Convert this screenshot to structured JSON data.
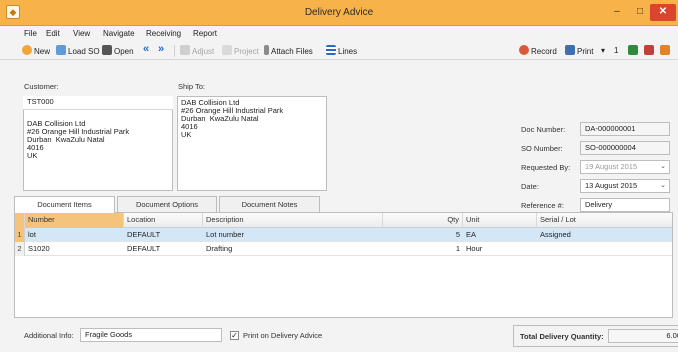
{
  "window": {
    "title": "Delivery Advice",
    "minimize_glyph": "–",
    "maximize_glyph": "□",
    "close_glyph": "✕"
  },
  "menu": [
    "File",
    "Edit",
    "View",
    "Navigate",
    "Receiving",
    "Report"
  ],
  "toolbar": {
    "new": "New",
    "load_so": "Load SO",
    "open": "Open",
    "prev": "«",
    "next": "»",
    "adjust": "Adjust",
    "project": "Project",
    "attach": "Attach Files",
    "lines": "Lines",
    "record": "Record",
    "print": "Print",
    "print_arrow": "▾",
    "copies": "1"
  },
  "customer": {
    "label": "Customer:",
    "code": "TST000",
    "address": "DAB Collision Ltd\n#26 Orange Hill Industrial Park\nDurban  KwaZulu Natal\n4016\nUK"
  },
  "ship_to": {
    "label": "Ship To:",
    "address": "DAB Collision Ltd\n#26 Orange Hill Industrial Park\nDurban  KwaZulu Natal\n4016\nUK"
  },
  "doc": {
    "doc_number_label": "Doc Number:",
    "doc_number": "DA-000000001",
    "so_number_label": "SO Number:",
    "so_number": "SO-000000004",
    "requested_by_label": "Requested By:",
    "requested_by": "19  August  2015",
    "date_label": "Date:",
    "date": "13  August  2015",
    "reference_label": "Reference #:",
    "reference": "Delivery"
  },
  "tabs": [
    "Document Items",
    "Document Options",
    "Document Notes"
  ],
  "grid": {
    "columns": [
      "Number",
      "Location",
      "Description",
      "Qty",
      "Unit",
      "Serial / Lot"
    ],
    "rows": [
      {
        "n": "1",
        "number": "lot",
        "location": "DEFAULT",
        "description": "Lot number",
        "qty": "5",
        "unit": "EA",
        "serial": "Assigned"
      },
      {
        "n": "2",
        "number": "S1020",
        "location": "DEFAULT",
        "description": "Drafting",
        "qty": "1",
        "unit": "Hour",
        "serial": ""
      }
    ]
  },
  "footer": {
    "additional_info_label": "Additional Info:",
    "additional_info": "Fragile Goods",
    "print_on_delivery": "Print on Delivery Advice",
    "total_label": "Total Delivery Quantity:",
    "total": "6.00"
  }
}
